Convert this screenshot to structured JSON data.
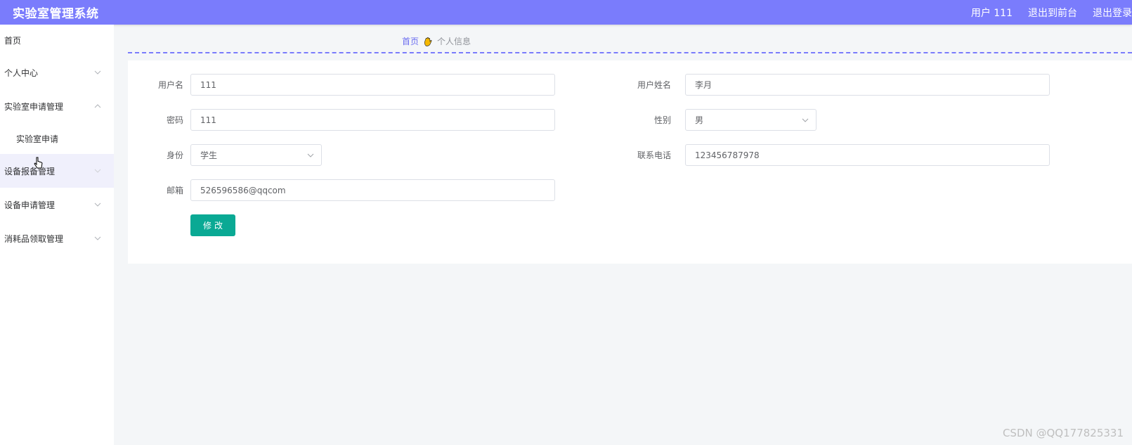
{
  "header": {
    "app_title": "实验室管理系统",
    "user_label": "用户 111",
    "back_to_front": "退出到前台",
    "logout": "退出登录",
    "bg_color": "#7a7cfc"
  },
  "sidebar": {
    "items": [
      {
        "label": "首页"
      },
      {
        "label": "个人中心"
      },
      {
        "label": "实验室申请管理"
      },
      {
        "label": "实验室申请"
      },
      {
        "label": "设备报备管理"
      },
      {
        "label": "设备申请管理"
      },
      {
        "label": "消耗品领取管理"
      }
    ]
  },
  "breadcrumb": {
    "home": "首页",
    "current": "个人信息"
  },
  "form": {
    "username_label": "用户名",
    "username_value": "111",
    "realname_label": "用户姓名",
    "realname_value": "李月",
    "password_label": "密码",
    "password_value": "111",
    "gender_label": "性别",
    "gender_value": "男",
    "role_label": "身份",
    "role_value": "学生",
    "phone_label": "联系电话",
    "phone_value": "123456787978",
    "email_label": "邮箱",
    "email_value": "526596586@qqcom",
    "submit_label": "修改",
    "accent_color": "#0aa994"
  },
  "watermark": "CSDN @QQ177825331"
}
